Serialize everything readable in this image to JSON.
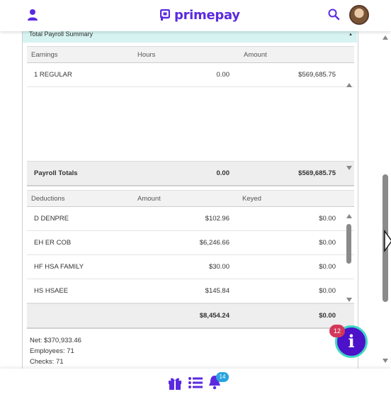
{
  "header": {
    "logo_text": "primepay",
    "brand_color": "#5b2ae0",
    "icons": [
      "user-icon",
      "search-icon",
      "avatar"
    ]
  },
  "summary": {
    "title": "Total Payroll Summary",
    "earnings_table": {
      "columns": [
        "Earnings",
        "Hours",
        "Amount"
      ],
      "rows": [
        {
          "name": "1 REGULAR",
          "hours": "0.00",
          "amount": "$569,685.75"
        }
      ],
      "totals": {
        "label": "Payroll Totals",
        "hours": "0.00",
        "amount": "$569,685.75"
      }
    },
    "deductions_table": {
      "columns": [
        "Deductions",
        "Amount",
        "Keyed"
      ],
      "rows": [
        {
          "name": "D DENPRE",
          "amount": "$102.96",
          "keyed": "$0.00"
        },
        {
          "name": "EH ER COB",
          "amount": "$6,246.66",
          "keyed": "$0.00"
        },
        {
          "name": "HF HSA FAMILY",
          "amount": "$30.00",
          "keyed": "$0.00"
        },
        {
          "name": "HS HSAEE",
          "amount": "$145.84",
          "keyed": "$0.00"
        }
      ],
      "totals": {
        "label": "",
        "amount": "$8,454.24",
        "keyed": "$0.00"
      }
    },
    "stats": {
      "net": "Net: $370,933.46",
      "employees": "Employees: 71",
      "checks": "Checks: 71"
    }
  },
  "fab": {
    "label": "i",
    "badge": "12",
    "color": "#4b12c9",
    "ring_color": "#3fd6c4"
  },
  "bottom_nav": {
    "icons": [
      "gift-icon",
      "list-icon",
      "bell-icon"
    ],
    "bell_badge": "14"
  }
}
